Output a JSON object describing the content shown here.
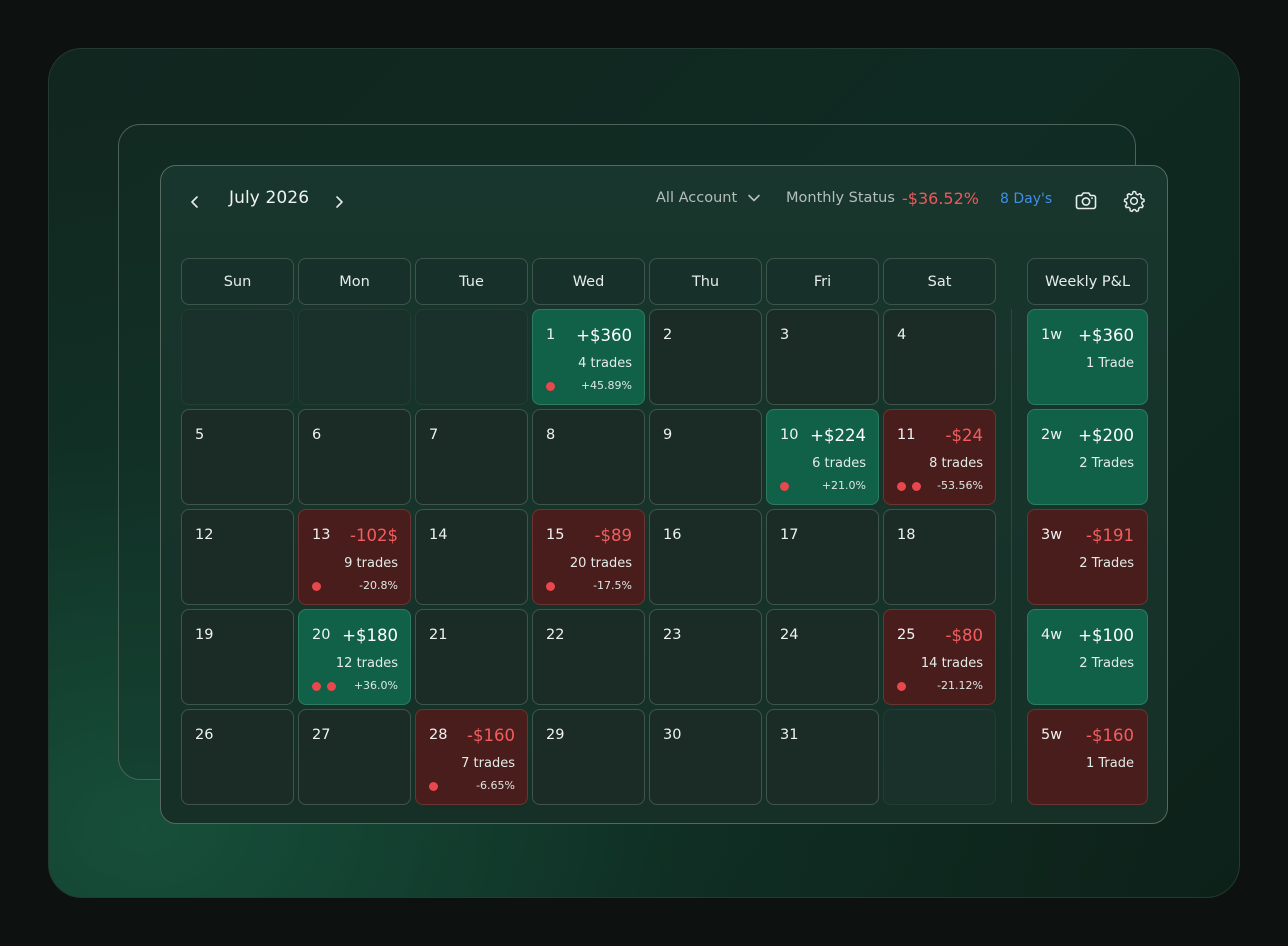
{
  "header": {
    "month": "July 2026",
    "account": "All Account",
    "status_label": "Monthly Status",
    "status_value": "-$36.52%",
    "days": "8 Day's"
  },
  "colors": {
    "positive": "#116149",
    "negative": "#4a1d1d",
    "negative_text": "#f35d5e",
    "link": "#3f8fe8",
    "dot": "#e8474c"
  },
  "weekdays": [
    "Sun",
    "Mon",
    "Tue",
    "Wed",
    "Thu",
    "Fri",
    "Sat"
  ],
  "weekly_header": "Weekly P&L",
  "days": [
    {
      "day": null
    },
    {
      "day": null
    },
    {
      "day": null
    },
    {
      "day": "1",
      "status": "pos",
      "pnl": "+$360",
      "trades": "4 trades",
      "pct": "+45.89%",
      "dots": 1
    },
    {
      "day": "2"
    },
    {
      "day": "3"
    },
    {
      "day": "4"
    },
    {
      "day": "5"
    },
    {
      "day": "6"
    },
    {
      "day": "7"
    },
    {
      "day": "8"
    },
    {
      "day": "9"
    },
    {
      "day": "10",
      "status": "pos",
      "pnl": "+$224",
      "trades": "6 trades",
      "pct": "+21.0%",
      "dots": 1
    },
    {
      "day": "11",
      "status": "neg",
      "pnl": "-$24",
      "trades": "8 trades",
      "pct": "-53.56%",
      "dots": 2
    },
    {
      "day": "12"
    },
    {
      "day": "13",
      "status": "neg",
      "pnl": "-102$",
      "trades": "9 trades",
      "pct": "-20.8%",
      "dots": 1
    },
    {
      "day": "14"
    },
    {
      "day": "15",
      "status": "neg",
      "pnl": "-$89",
      "trades": "20 trades",
      "pct": "-17.5%",
      "dots": 1
    },
    {
      "day": "16"
    },
    {
      "day": "17"
    },
    {
      "day": "18"
    },
    {
      "day": "19"
    },
    {
      "day": "20",
      "status": "pos",
      "pnl": "+$180",
      "trades": "12 trades",
      "pct": "+36.0%",
      "dots": 2
    },
    {
      "day": "21"
    },
    {
      "day": "22"
    },
    {
      "day": "23"
    },
    {
      "day": "24"
    },
    {
      "day": "25",
      "status": "neg",
      "pnl": "-$80",
      "trades": "14 trades",
      "pct": "-21.12%",
      "dots": 1
    },
    {
      "day": "26"
    },
    {
      "day": "27"
    },
    {
      "day": "28",
      "status": "neg",
      "pnl": "-$160",
      "trades": "7 trades",
      "pct": "-6.65%",
      "dots": 1
    },
    {
      "day": "29"
    },
    {
      "day": "30"
    },
    {
      "day": "31"
    },
    {
      "day": null
    }
  ],
  "weeks": [
    {
      "label": "1w",
      "status": "pos",
      "pnl": "+$360",
      "trades": "1 Trade"
    },
    {
      "label": "2w",
      "status": "pos",
      "pnl": "+$200",
      "trades": "2 Trades"
    },
    {
      "label": "3w",
      "status": "neg",
      "pnl": "-$191",
      "trades": "2 Trades"
    },
    {
      "label": "4w",
      "status": "pos",
      "pnl": "+$100",
      "trades": "2 Trades"
    },
    {
      "label": "5w",
      "status": "neg",
      "pnl": "-$160",
      "trades": "1 Trade"
    }
  ]
}
